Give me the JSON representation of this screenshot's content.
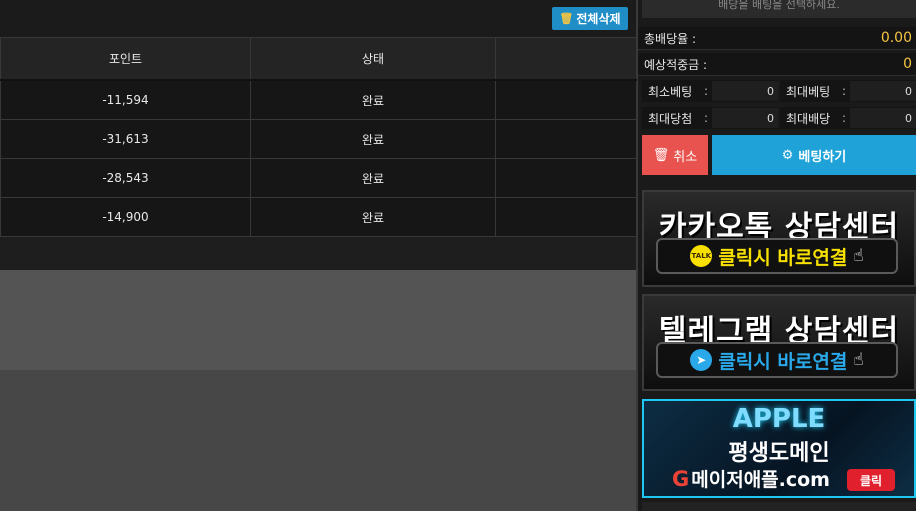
{
  "header": {
    "delete_all_label": "전체삭제",
    "delete_icon": "trash-icon"
  },
  "table": {
    "columns": [
      "포인트",
      "상태",
      ""
    ],
    "rows": [
      {
        "points": "-11,594",
        "status": "완료"
      },
      {
        "points": "-31,613",
        "status": "완료"
      },
      {
        "points": "-28,543",
        "status": "완료"
      },
      {
        "points": "-14,900",
        "status": "완료"
      }
    ]
  },
  "betslip": {
    "top_note": "배당을 배팅을 선택하세요.",
    "total_odds_label": "총배당율 :",
    "total_odds_value": "0.00",
    "expected_win_label": "예상적중금 :",
    "expected_win_value": "0",
    "min_bet_label": "최소베팅",
    "min_bet_value": "0",
    "max_bet_label": "최대베팅",
    "max_bet_value": "0",
    "max_win_label": "최대당첨",
    "max_win_value": "0",
    "max_odds_label": "최대배당",
    "max_odds_value": "0",
    "colon": ":",
    "cancel_label": "취소",
    "bet_label": "베팅하기"
  },
  "banners": {
    "kakao_title": "카카오톡 상담센터",
    "kakao_cta": "클릭시 바로연결",
    "kakao_icon_text": "TALK",
    "telegram_title": "텔레그램 상담센터",
    "telegram_cta": "클릭시 바로연결",
    "apple_logo": "APPLE",
    "apple_sub": "평생도메인",
    "apple_domain": "메이저애플.com",
    "apple_click": "클릭"
  },
  "colors": {
    "accent": "#1ea2d8",
    "danger": "#e8534f",
    "highlight": "#f5c542"
  }
}
